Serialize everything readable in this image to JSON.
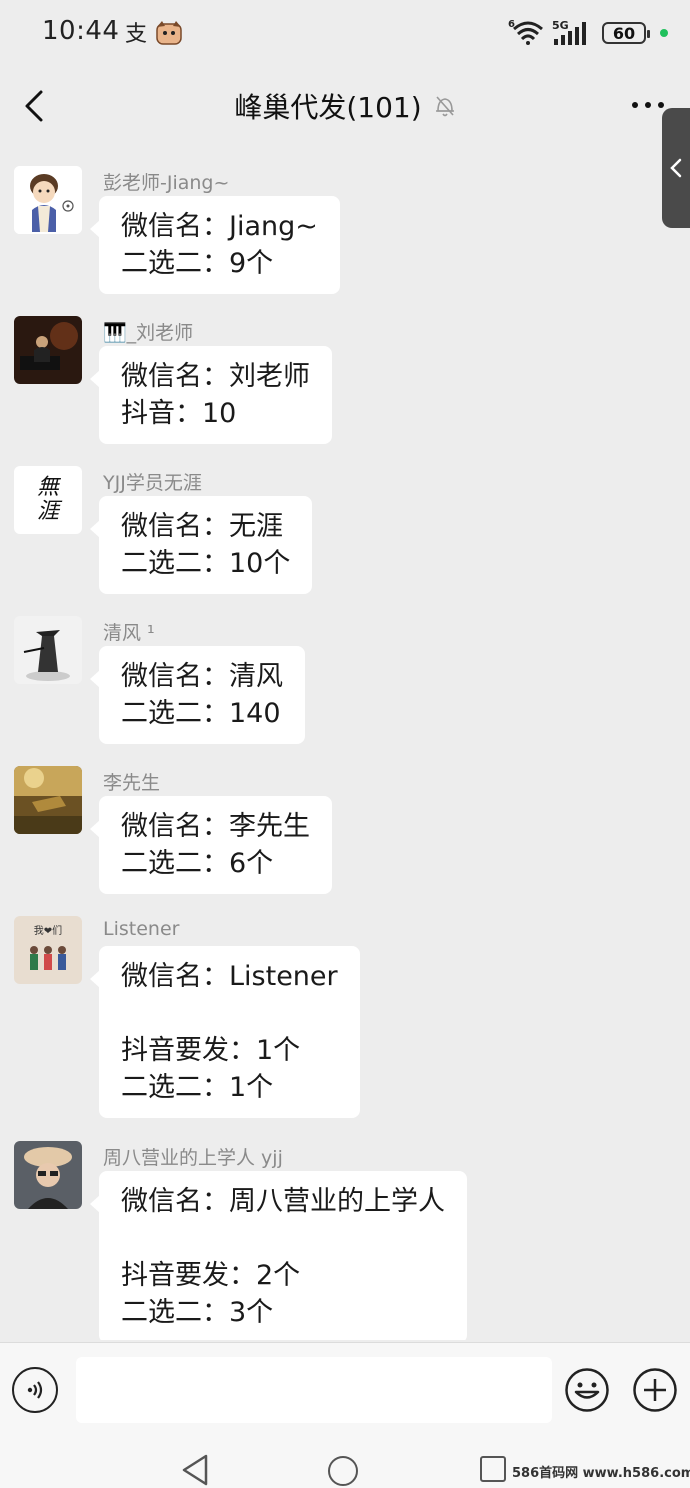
{
  "status_bar": {
    "time": "10:44",
    "network_label": "5G",
    "wifi_badge": "6",
    "battery": "60"
  },
  "header": {
    "title": "峰巢代发(101)"
  },
  "messages": [
    {
      "sender": "彭老师-Jiang~",
      "lines": [
        "微信名：Jiang~",
        "二选二：9个"
      ]
    },
    {
      "sender": "🎹_刘老师",
      "lines": [
        "微信名：刘老师",
        "抖音：10"
      ]
    },
    {
      "sender": "YJJ学员无涯",
      "lines": [
        "微信名：无涯",
        "二选二：10个"
      ]
    },
    {
      "sender": "清风 ¹",
      "lines": [
        "微信名：清风",
        "二选二：140"
      ]
    },
    {
      "sender": "李先生",
      "lines": [
        "微信名：李先生",
        "二选二：6个"
      ]
    },
    {
      "sender": "Listener",
      "lines": [
        "微信名：Listener",
        "",
        "抖音要发：1个",
        "二选二：1个"
      ]
    },
    {
      "sender": "周八营业的上学人  yjj",
      "lines": [
        "微信名：周八营业的上学人",
        "",
        "抖音要发：2个",
        "二选二：3个"
      ]
    }
  ],
  "avatar_logo_text": "無涯",
  "avatar_listener_text": "我❤们",
  "watermark": "586首码网 www.h586.com",
  "icons": [
    "back-icon",
    "mute-bell-icon",
    "more-icon",
    "collapse-arrow-icon",
    "voice-icon",
    "emoji-icon",
    "plus-icon"
  ],
  "colors": {
    "background": "#ededed",
    "bubble": "#ffffff",
    "sender": "#8a8a8a"
  }
}
